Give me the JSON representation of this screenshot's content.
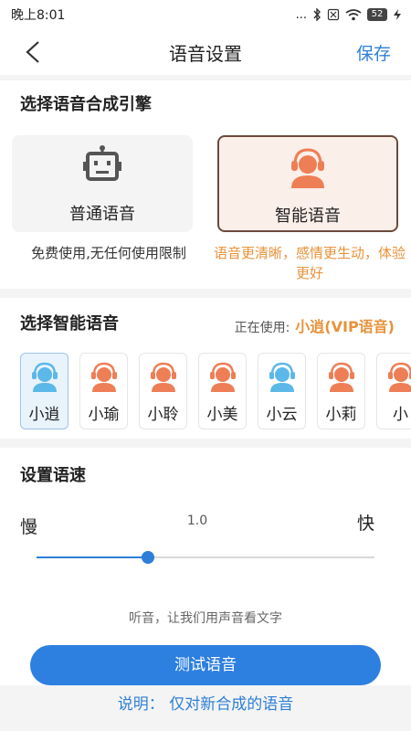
{
  "status_bar": {
    "time": "晚上8:01",
    "signal": "...",
    "battery": "52"
  },
  "header": {
    "title": "语音设置",
    "save_label": "保存"
  },
  "engine_section": {
    "title": "选择语音合成引擎",
    "normal": {
      "label": "普通语音",
      "description": "免费使用,无任何使用限制",
      "icon": "robot-icon"
    },
    "smart": {
      "label": "智能语音",
      "description": "语音更清晰，感情更生动，体验更好",
      "icon": "headset-person-icon",
      "selected": true
    }
  },
  "voice_section": {
    "title": "选择智能语音",
    "in_use_label": "正在使用:",
    "in_use_name": "小逍(VIP语音)",
    "voices": [
      {
        "name": "小逍",
        "avatar_color": "#5bb8e8",
        "selected": true
      },
      {
        "name": "小瑜",
        "avatar_color": "#ee7e55",
        "selected": false
      },
      {
        "name": "小聆",
        "avatar_color": "#ee7e55",
        "selected": false
      },
      {
        "name": "小美",
        "avatar_color": "#ee7e55",
        "selected": false
      },
      {
        "name": "小云",
        "avatar_color": "#5bb8e8",
        "selected": false
      },
      {
        "name": "小莉",
        "avatar_color": "#ee7e55",
        "selected": false
      },
      {
        "name": "小",
        "avatar_color": "#ee7e55",
        "selected": false
      }
    ]
  },
  "speed_section": {
    "title": "设置语速",
    "slow_label": "慢",
    "fast_label": "快",
    "value": "1.0",
    "slider_fraction": 0.33,
    "hint": "听音，让我们用声音看文字",
    "test_button": "测试语音"
  },
  "note": "说明：  仅对新合成的语音",
  "colors": {
    "accent": "#2e7fd8",
    "orange": "#e8923a",
    "avatar_orange": "#ee7e55",
    "avatar_blue": "#5bb8e8"
  }
}
